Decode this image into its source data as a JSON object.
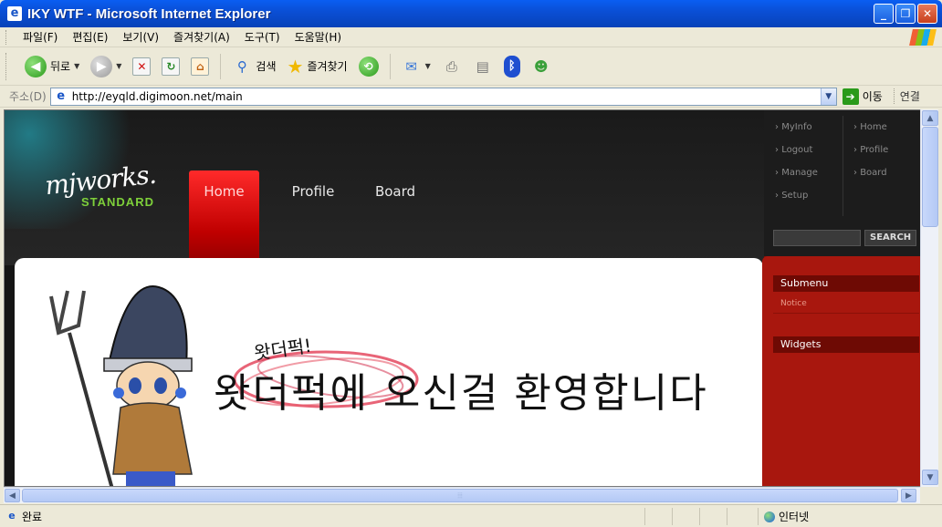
{
  "window": {
    "title": "IKY WTF - Microsoft Internet Explorer",
    "buttons": {
      "minimize": "_",
      "maximize": "❐",
      "close": "✕"
    }
  },
  "menubar": {
    "items": [
      "파일(F)",
      "편집(E)",
      "보기(V)",
      "즐겨찾기(A)",
      "도구(T)",
      "도움말(H)"
    ]
  },
  "toolbar": {
    "back_label": "뒤로",
    "search_label": "검색",
    "favorites_label": "즐겨찾기"
  },
  "addressbar": {
    "label": "주소(D)",
    "url": "http://eyqld.digimoon.net/main",
    "go_label": "이동",
    "links_label": "연결"
  },
  "site": {
    "logo_script": "mjworks.",
    "logo_sub": "STANDARD",
    "nav": [
      "Home",
      "Profile",
      "Board"
    ],
    "active_nav": "Home",
    "welcome_small": "왓더퍽!",
    "welcome_text": "왓더퍽에 오신걸 환영합니다",
    "side_links_left": [
      "MyInfo",
      "Logout",
      "Manage",
      "Setup"
    ],
    "side_links_right": [
      "Home",
      "Profile",
      "Board"
    ],
    "search_button": "SEARCH",
    "submenu_title": "Submenu",
    "submenu_items": [
      "Notice"
    ],
    "widgets_title": "Widgets",
    "colors": {
      "nav_active": "#e01010",
      "sidebar_red": "#a8170e",
      "sidebar_header": "#6e0a04",
      "logo_green": "#7ed03a"
    }
  },
  "statusbar": {
    "status": "완료",
    "zone": "인터넷"
  }
}
